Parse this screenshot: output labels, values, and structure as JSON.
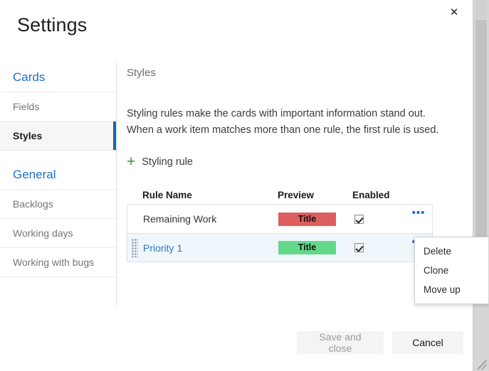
{
  "dialog": {
    "title": "Settings",
    "close_icon": "close-icon"
  },
  "sidebar": {
    "groups": [
      {
        "header": "Cards",
        "items": [
          {
            "label": "Fields",
            "selected": false
          },
          {
            "label": "Styles",
            "selected": true
          }
        ]
      },
      {
        "header": "General",
        "items": [
          {
            "label": "Backlogs",
            "selected": false
          },
          {
            "label": "Working days",
            "selected": false
          },
          {
            "label": "Working with bugs",
            "selected": false
          }
        ]
      }
    ]
  },
  "content": {
    "heading": "Styles",
    "description": "Styling rules make the cards with important information stand out. When a work item matches more than one rule, the first rule is used.",
    "add_rule": {
      "plus_glyph": "+",
      "label": "Styling rule"
    },
    "table": {
      "columns": [
        "Rule Name",
        "Preview",
        "Enabled"
      ],
      "rows": [
        {
          "name": "Remaining Work",
          "preview_label": "Title",
          "preview_color": "#DD5E5E",
          "enabled": true,
          "selected": false,
          "actions_glyph": "•••"
        },
        {
          "name": "Priority 1",
          "preview_label": "Title",
          "preview_color": "#62D98A",
          "enabled": true,
          "selected": true,
          "actions_glyph": "•••"
        }
      ]
    }
  },
  "context_menu": {
    "items": [
      "Delete",
      "Clone",
      "Move up"
    ]
  },
  "footer": {
    "save_label": "Save and close",
    "cancel_label": "Cancel"
  },
  "colors": {
    "accent": "#0d66c0",
    "link": "#1f6fc0",
    "selected_row": "#eff6fc",
    "add_icon": "#2d9a2d"
  }
}
